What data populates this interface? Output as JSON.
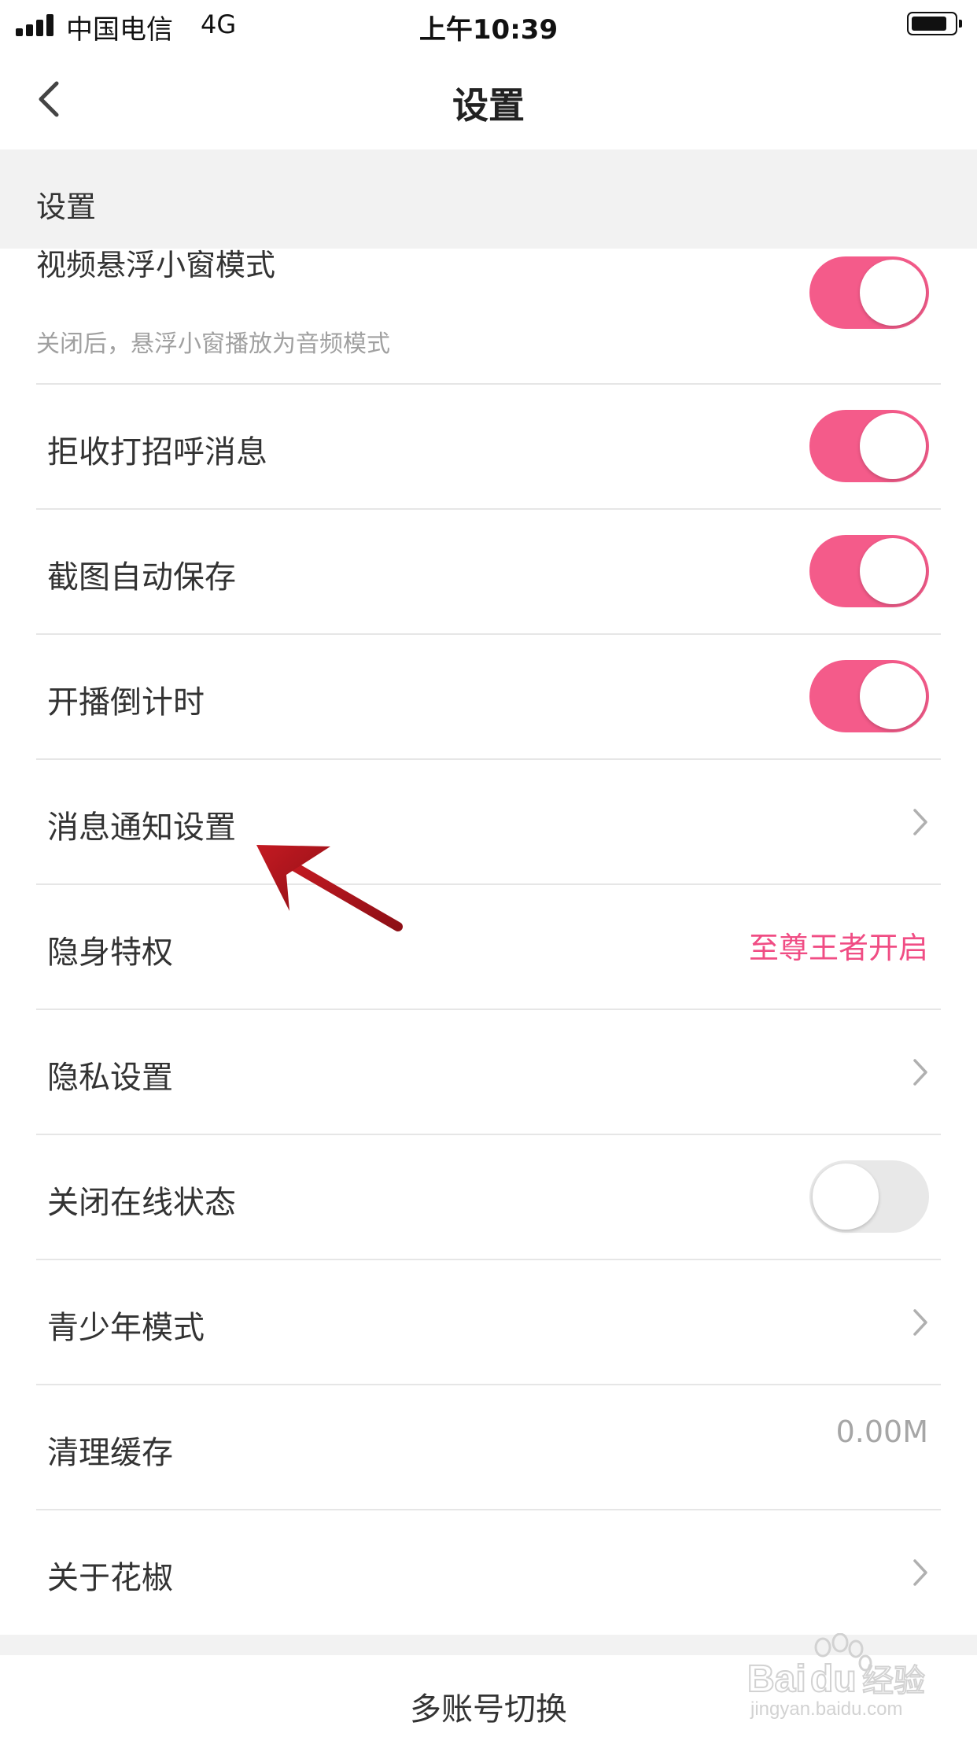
{
  "status_bar": {
    "carrier": "中国电信",
    "network": "4G",
    "time": "上午10:39",
    "battery_level": 0.85
  },
  "nav": {
    "title": "设置"
  },
  "section_header": "设置",
  "rows": [
    {
      "label": "视频悬浮小窗模式",
      "subtitle": "关闭后，悬浮小窗播放为音频模式",
      "type": "toggle",
      "on": true
    },
    {
      "label": "拒收打招呼消息",
      "type": "toggle",
      "on": true
    },
    {
      "label": "截图自动保存",
      "type": "toggle",
      "on": true
    },
    {
      "label": "开播倒计时",
      "type": "toggle",
      "on": true
    },
    {
      "label": "消息通知设置",
      "type": "chevron"
    },
    {
      "label": "隐身特权",
      "type": "value",
      "value": "至尊王者开启",
      "value_color": "#f04d84"
    },
    {
      "label": "隐私设置",
      "type": "chevron"
    },
    {
      "label": "关闭在线状态",
      "type": "toggle",
      "on": false
    },
    {
      "label": "青少年模式",
      "type": "chevron"
    },
    {
      "label": "清理缓存",
      "type": "value",
      "value": "0.00M",
      "value_color": "#a6a6a6"
    },
    {
      "label": "关于花椒",
      "type": "chevron"
    }
  ],
  "bottom": {
    "switch_account": "多账号切换"
  },
  "watermark": {
    "logo_text": "Baidu经验",
    "url": "jingyan.baidu.com"
  },
  "colors": {
    "toggle_on": "#f45b8a",
    "toggle_off": "#e8e8e8",
    "arrow": "#b3151e",
    "section_bg": "#f2f2f2"
  }
}
